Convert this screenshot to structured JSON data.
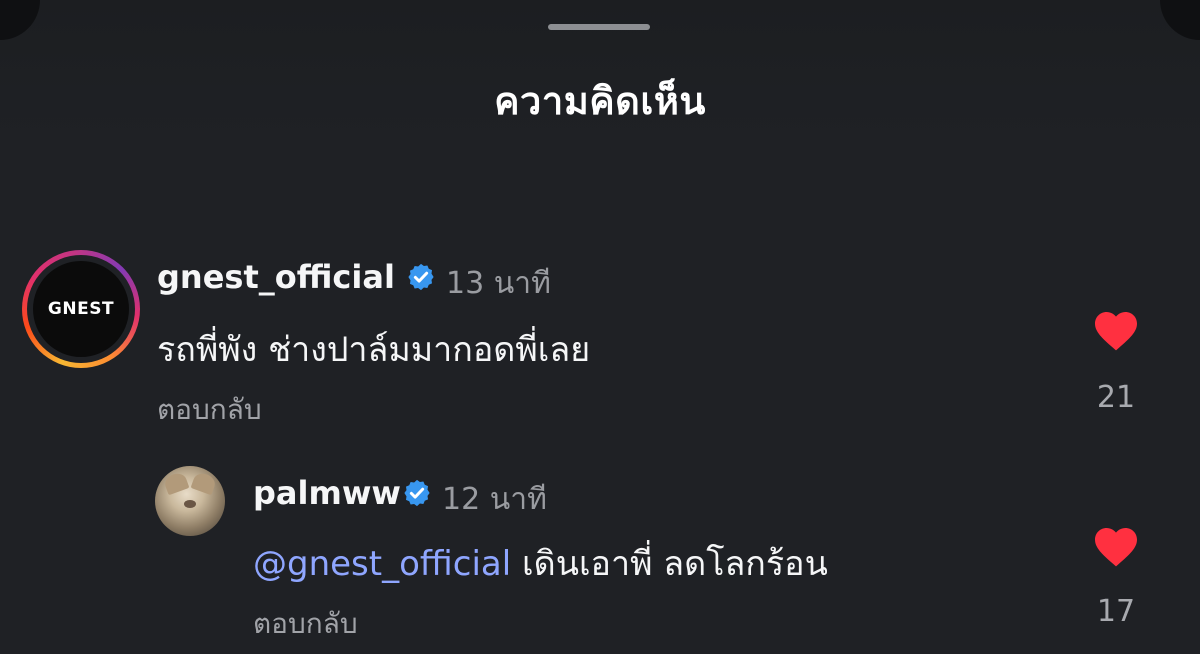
{
  "header": {
    "title": "ความคิดเห็น"
  },
  "comments": [
    {
      "username": "gnest_official",
      "verified": true,
      "time": "13 นาที",
      "avatar_text": "GNEST",
      "text": "รถพี่พัง ช่างปาล์มมากอดพี่เลย",
      "reply_label": "ตอบกลับ",
      "likes": "21",
      "liked": true
    },
    {
      "username": "palmww",
      "verified": true,
      "time": "12 นาที",
      "mention": "@gnest_official",
      "text": " เดินเอาพี่ ลดโลกร้อน",
      "reply_label": "ตอบกลับ",
      "likes": "17",
      "liked": true
    }
  ],
  "colors": {
    "background": "#1f2125",
    "heart": "#ff3040",
    "mention": "#8fa6ff",
    "verified": "#3897f0"
  },
  "icons": {
    "verified": "verified-badge-icon",
    "heart": "heart-filled-icon"
  }
}
